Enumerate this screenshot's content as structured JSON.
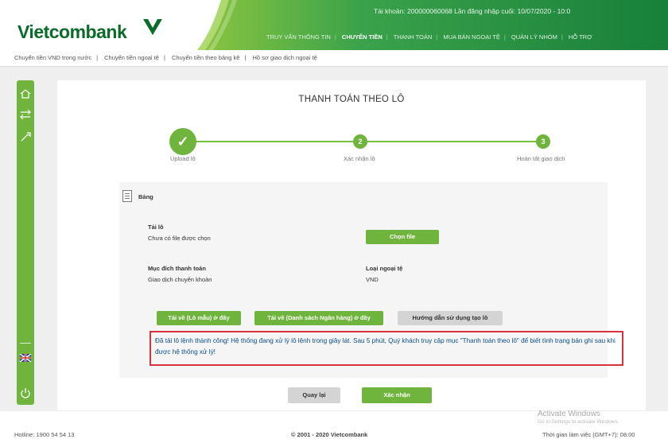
{
  "header": {
    "logo_text": "Vietcombank",
    "account_info": "Tài khoản: 200000060068     Lần đăng nhập cuối: 10/07/2020 - 10:0",
    "nav": [
      "TRUY VẤN THÔNG TIN",
      "CHUYỂN TIỀN",
      "THANH TOÁN",
      "MUA BÁN NGOẠI TỆ",
      "QUẢN LÝ NHÓM",
      "HỖ TRỢ"
    ],
    "nav_active_index": 1
  },
  "subnav": [
    "Chuyển tiền VND trong nước",
    "Chuyển tiền ngoại tệ",
    "Chuyển tiền theo bảng kê",
    "Hồ sơ giao dịch ngoại tệ"
  ],
  "sidebar": {
    "icons": [
      "home-icon",
      "transfer-icon",
      "tool-icon",
      "flag-uk-icon",
      "power-icon"
    ]
  },
  "page": {
    "title": "THANH TOÁN THEO LÔ",
    "steps": [
      {
        "label": "Upload lô",
        "marker": "✓"
      },
      {
        "label": "Xác nhận lô",
        "marker": "2"
      },
      {
        "label": "Hoàn tất giao dịch",
        "marker": "3"
      }
    ],
    "panel_title": "Bảng",
    "file_label": "Tải lô",
    "file_value": "Chưa có file được chọn",
    "choose_file_button": "Chọn file",
    "purpose_label": "Mục đích thanh toán",
    "purpose_value": "Giao dịch chuyển khoản",
    "currency_label": "Loại ngoại tệ",
    "currency_value": "VND",
    "download_template_button": "Tải về (Lô mẫu) ở đây",
    "download_bank_list_button": "Tải về (Danh sách Ngân hàng) ở đây",
    "guide_button": "Hướng dẫn sử dụng tạo lô",
    "notice": "Đã tải lô lệnh thành công! Hệ thống đang xử lý lô lệnh trong giây lát. Sau 5 phút, Quý khách truy cập mục \"Thanh toán theo lô\" để biết tình trạng bản ghi sau khi được hệ thống xử lý!",
    "back_button": "Quay lại",
    "confirm_button": "Xác nhận"
  },
  "footer": {
    "hotline": "Hotline: 1900 54 54 13",
    "copyright": "© 2001 - 2020 Vietcombank",
    "worktime": "Thời gian làm việc (GMT+7): 08:00",
    "watermark_title": "Activate Windows",
    "watermark_sub": "Go to Settings to activate Windows."
  },
  "colors": {
    "brand_green": "#6fb43c",
    "dark_green": "#0a6b2a",
    "notice_border": "#d9323c",
    "notice_text": "#0b4e8a"
  }
}
